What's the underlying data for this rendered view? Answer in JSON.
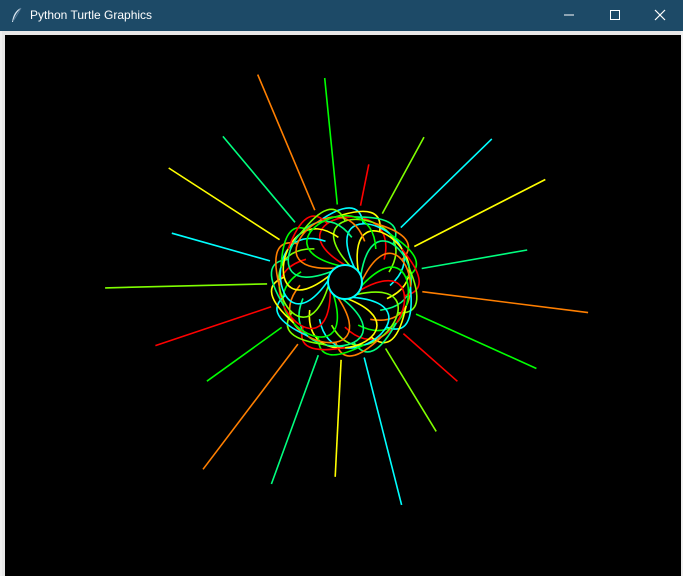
{
  "window": {
    "title": "Python Turtle Graphics",
    "icon": "feather-icon",
    "controls": [
      "minimize-icon",
      "maximize-icon",
      "close-icon"
    ]
  },
  "canvas": {
    "background": "#000000",
    "drawing": "spirograph-flower",
    "colors": [
      "#ff0000",
      "#ff7f00",
      "#ffff00",
      "#7fff00",
      "#00ff00",
      "#00ff7f",
      "#00ffff"
    ]
  }
}
